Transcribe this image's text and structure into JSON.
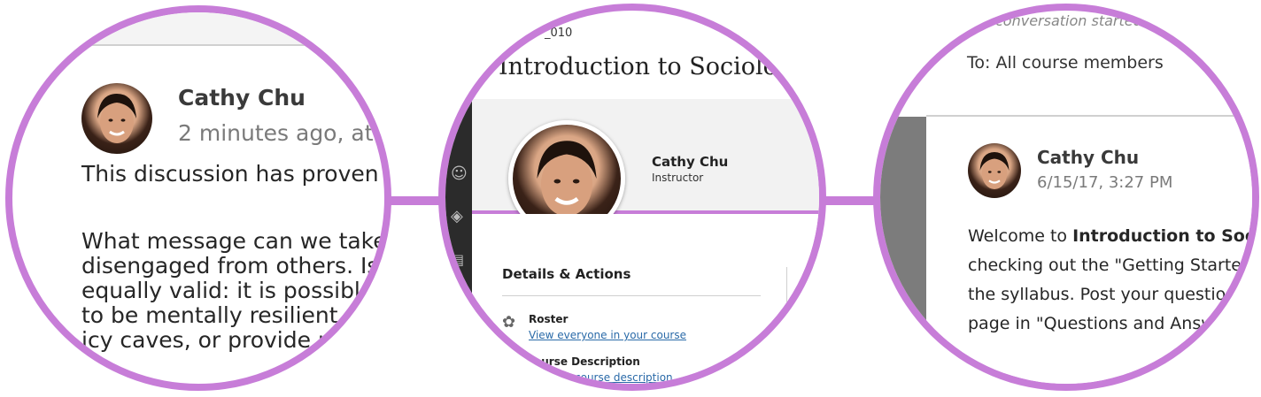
{
  "panel_left": {
    "author_name": "Cathy Chu",
    "timestamp": "2 minutes ago, at",
    "paragraph_1": "This discussion has proven",
    "paragraph_2_lines": [
      "What message can we take",
      "disengaged from others. Is",
      "equally valid: it is possible",
      "to be mentally resilient.",
      "icy caves, or provide m"
    ]
  },
  "panel_middle": {
    "course_id": "_010",
    "course_title": "Introduction to Sociolo",
    "instructor_name": "Cathy Chu",
    "instructor_role": "Instructor",
    "details_heading": "Details & Actions",
    "roster_label": "Roster",
    "roster_link": "View everyone in your course",
    "course_description_label": "ourse Description",
    "course_description_link": "course description"
  },
  "panel_right": {
    "top_partial": "conversation started:",
    "to_line": "To: All course members",
    "author_name": "Cathy Chu",
    "timestamp": "6/15/17, 3:27 PM",
    "message_prefix": "Welcome to ",
    "message_bold": "Introduction to Soc",
    "message_lines": [
      "checking out the \"Getting Starte",
      "the syllabus. Post your questio",
      "page in \"Questions and Answ"
    ]
  },
  "colors": {
    "ring": "#c77dd8",
    "link": "#2a6aa8",
    "muted": "#7a7a7a",
    "dark_sidebar": "#2b2b2b"
  }
}
